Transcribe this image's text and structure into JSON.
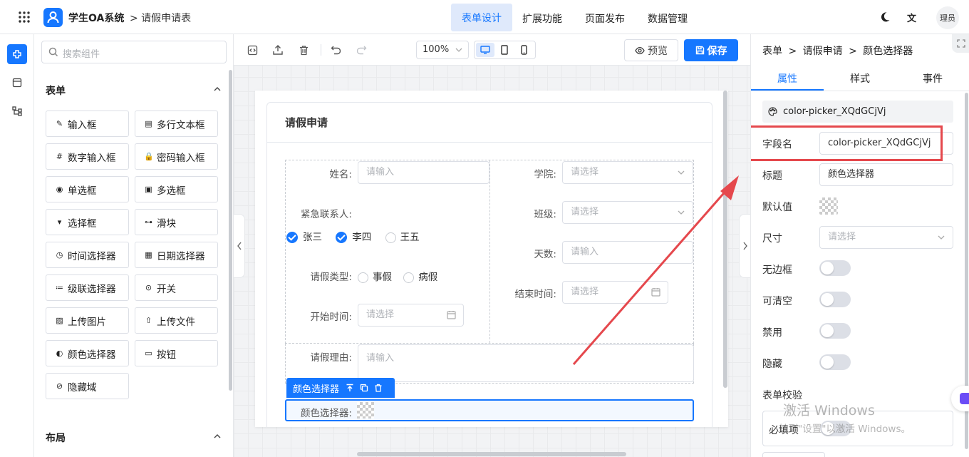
{
  "header": {
    "app_name": "学生OA系统",
    "breadcrumb": "> 请假申请表",
    "nav": [
      "表单设计",
      "扩展功能",
      "页面发布",
      "数据管理"
    ],
    "avatar_text": "理员"
  },
  "palette": {
    "search_placeholder": "搜索组件",
    "form_section": "表单",
    "items": [
      {
        "label": "输入框",
        "icon": "pencil-icon"
      },
      {
        "label": "多行文本框",
        "icon": "textarea-icon"
      },
      {
        "label": "数字输入框",
        "icon": "number-icon"
      },
      {
        "label": "密码输入框",
        "icon": "lock-icon"
      },
      {
        "label": "单选框",
        "icon": "radio-icon"
      },
      {
        "label": "多选框",
        "icon": "checkbox-icon"
      },
      {
        "label": "选择框",
        "icon": "select-icon"
      },
      {
        "label": "滑块",
        "icon": "slider-icon"
      },
      {
        "label": "时间选择器",
        "icon": "clock-icon"
      },
      {
        "label": "日期选择器",
        "icon": "calendar-icon"
      },
      {
        "label": "级联选择器",
        "icon": "cascade-icon"
      },
      {
        "label": "开关",
        "icon": "switch-icon"
      },
      {
        "label": "上传图片",
        "icon": "image-icon"
      },
      {
        "label": "上传文件",
        "icon": "upload-icon"
      },
      {
        "label": "颜色选择器",
        "icon": "palette-icon"
      },
      {
        "label": "按钮",
        "icon": "button-icon"
      },
      {
        "label": "隐藏域",
        "icon": "eye-off-icon"
      }
    ],
    "layout_section": "布局"
  },
  "toolbar": {
    "zoom": "100%",
    "preview_label": "预览",
    "save_label": "保存"
  },
  "form": {
    "title": "请假申请",
    "name_label": "姓名:",
    "name_placeholder": "请输入",
    "college_label": "学院:",
    "college_placeholder": "请选择",
    "class_label": "班级:",
    "class_placeholder": "请选择",
    "contact_label": "紧急联系人:",
    "contacts": [
      {
        "label": "张三",
        "checked": true
      },
      {
        "label": "李四",
        "checked": true
      },
      {
        "label": "王五",
        "checked": false
      }
    ],
    "days_label": "天数:",
    "days_placeholder": "请输入",
    "leave_type_label": "请假类型:",
    "leave_types": [
      "事假",
      "病假"
    ],
    "end_time_label": "结束时间:",
    "end_time_placeholder": "请选择",
    "start_time_label": "开始时间:",
    "start_time_placeholder": "请选择",
    "reason_label": "请假理由:",
    "reason_placeholder": "请输入",
    "selected_tag": "颜色选择器",
    "color_label": "颜色选择器:"
  },
  "props": {
    "breadcrumb": [
      "表单",
      "请假申请",
      "颜色选择器"
    ],
    "tabs": [
      "属性",
      "样式",
      "事件"
    ],
    "active_tab": "属性",
    "component_id": "color-picker_XQdGCjVj",
    "field_name_label": "字段名",
    "field_name_value": "color-picker_XQdGCjVj",
    "title_label": "标题",
    "title_value": "颜色选择器",
    "default_label": "默认值",
    "size_label": "尺寸",
    "size_placeholder": "请选择",
    "toggles": [
      {
        "label": "无边框",
        "on": false
      },
      {
        "label": "可清空",
        "on": false
      },
      {
        "label": "禁用",
        "on": false
      },
      {
        "label": "隐藏",
        "on": false
      }
    ],
    "validation_label": "表单校验",
    "required_label": "必填项",
    "required_on": false
  },
  "watermark": {
    "line1": "激活 Windows",
    "line2": "转到\"设置\"以激活 Windows。"
  },
  "colors": {
    "primary": "#1677ff",
    "highlight_box": "#e5484d",
    "arrow": "#e5484d"
  }
}
